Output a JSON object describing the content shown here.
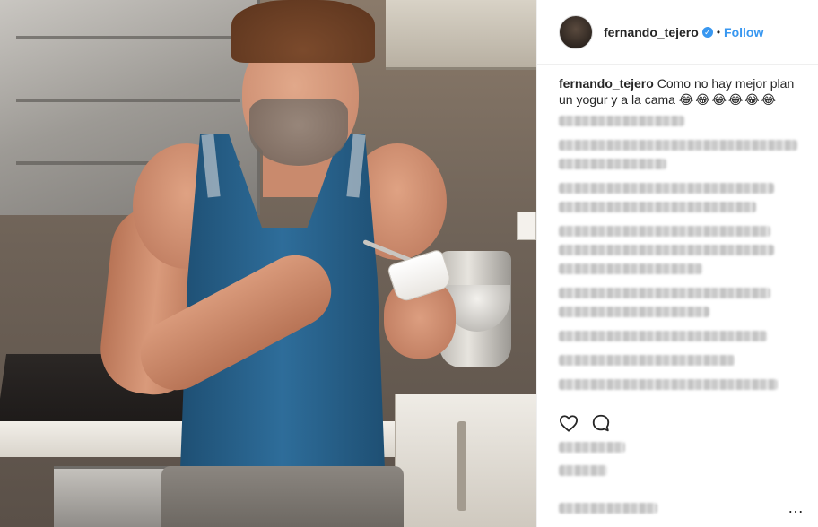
{
  "header": {
    "username": "fernando_tejero",
    "verified_glyph": "✓",
    "separator": "•",
    "follow_label": "Follow"
  },
  "caption": {
    "username": "fernando_tejero",
    "text": "Como no hay mejor plan un yogur y a la cama",
    "emojis": "😂😂😂😂😂😂"
  },
  "more_options": "…",
  "icons": {
    "like": "heart-icon",
    "comment": "comment-icon",
    "more": "more-options-icon"
  },
  "colors": {
    "link": "#3897f0",
    "text": "#262626",
    "divider": "#efefef"
  }
}
